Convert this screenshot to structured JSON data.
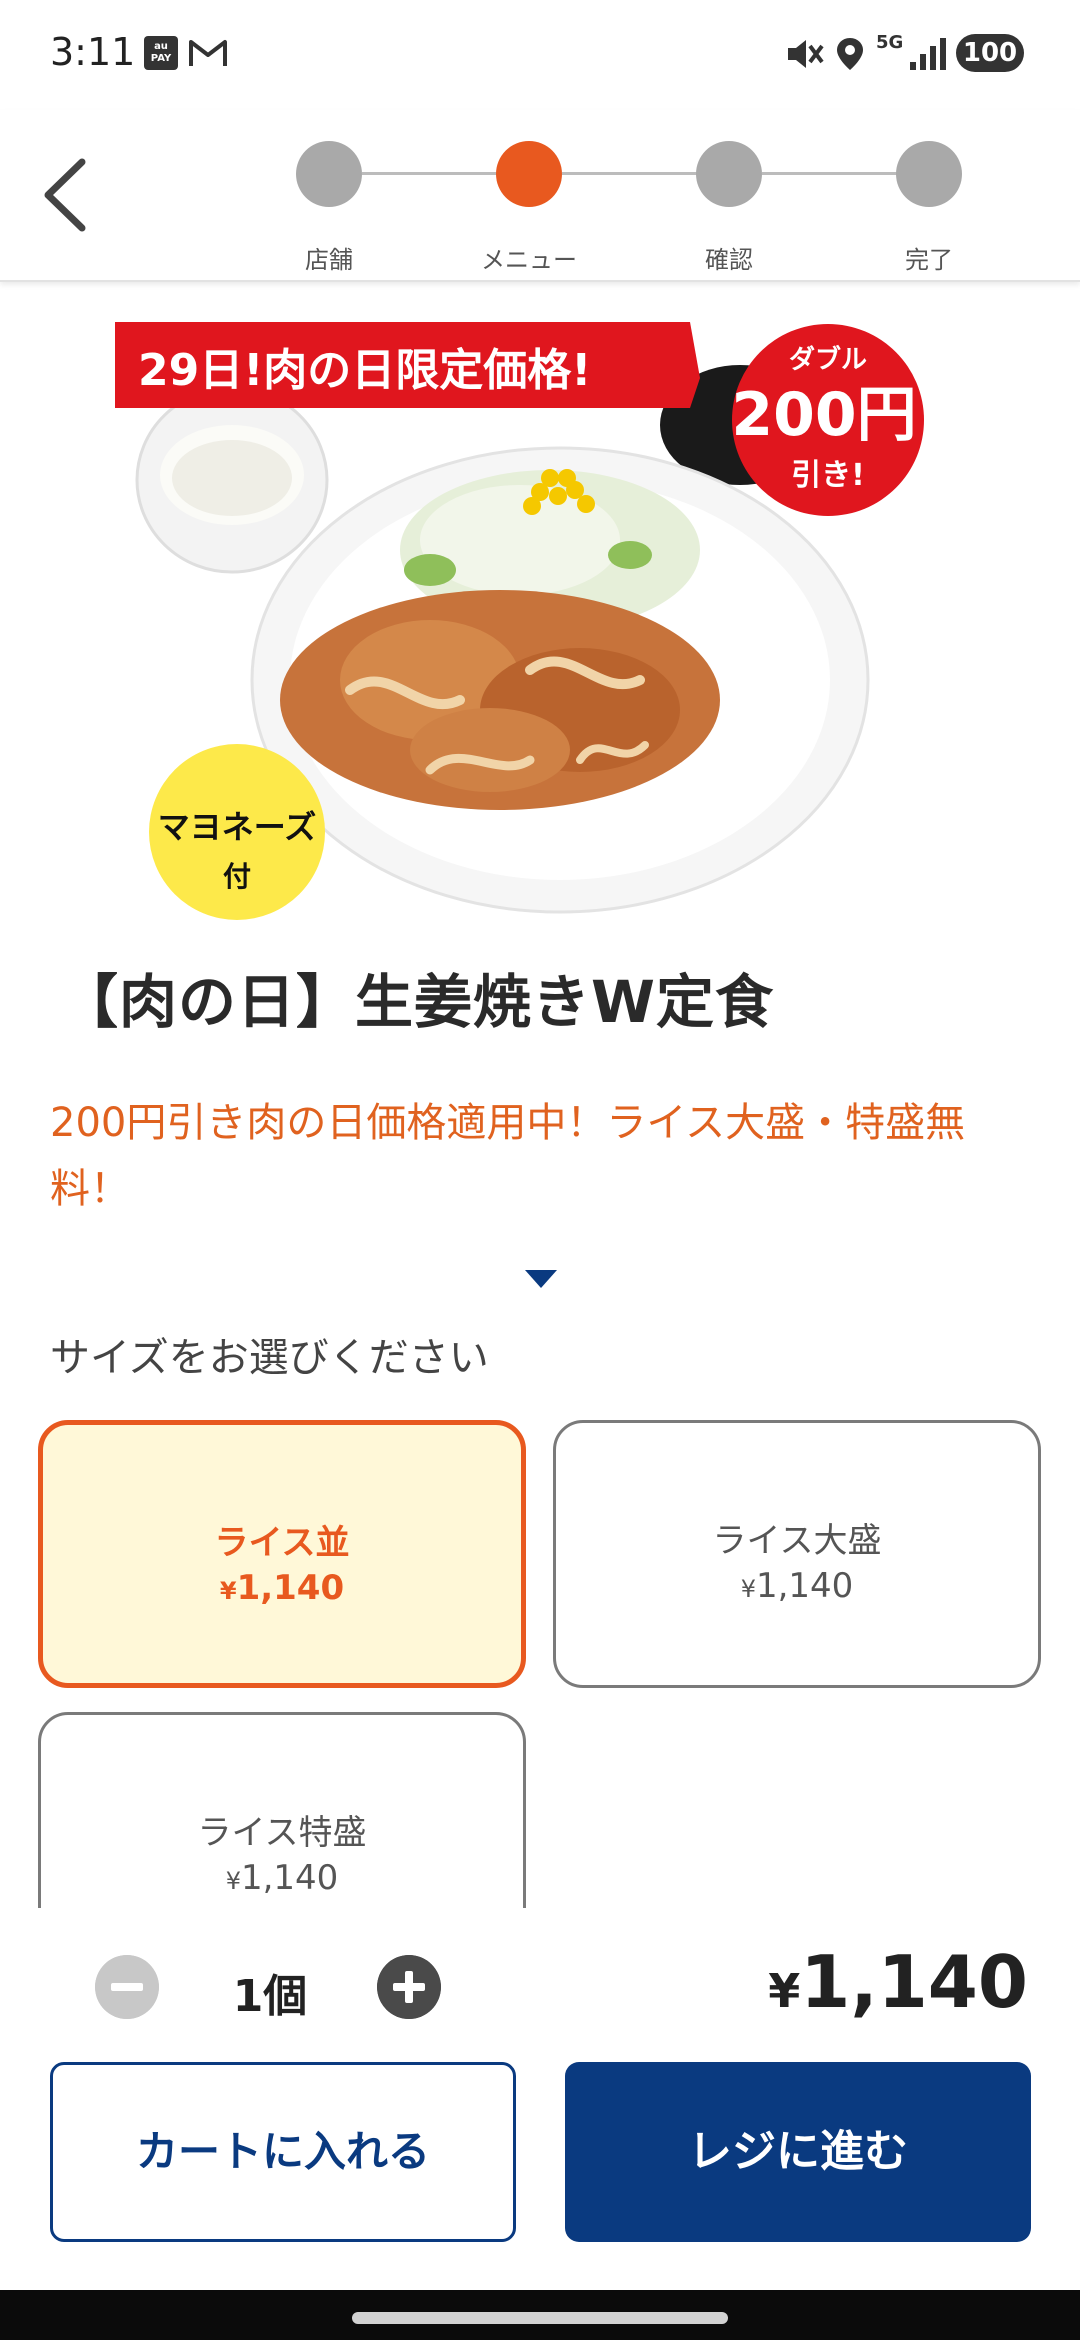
{
  "status_bar": {
    "time": "3:11",
    "pay_icon_label": "au PAY",
    "network": "5G",
    "battery": "100"
  },
  "header": {
    "steps": [
      {
        "label": "店舗",
        "active": false
      },
      {
        "label": "メニュー",
        "active": true
      },
      {
        "label": "確認",
        "active": false
      },
      {
        "label": "完了",
        "active": false
      }
    ]
  },
  "hero": {
    "banner_text": "29日!肉の日限定価格!",
    "discount_badge_top": "ダブル",
    "discount_badge_amount": "200円",
    "discount_badge_bottom": "引き!",
    "mayo_badge_line1": "マヨネーズ",
    "mayo_badge_line2": "付"
  },
  "product": {
    "title": "【肉の日】生姜焼きW定食",
    "promo": "200円引き肉の日価格適用中！ライス大盛・特盛無料！"
  },
  "size_section": {
    "prompt": "サイズをお選びください",
    "options": [
      {
        "name": "ライス並",
        "currency": "¥",
        "price": "1,140",
        "selected": true
      },
      {
        "name": "ライス大盛",
        "currency": "¥",
        "price": "1,140",
        "selected": false
      },
      {
        "name": "ライス特盛",
        "currency": "¥",
        "price": "1,140",
        "selected": false
      }
    ]
  },
  "order": {
    "quantity": "1個",
    "currency": "¥",
    "total": "1,140",
    "cart_label": "カートに入れる",
    "checkout_label": "レジに進む"
  },
  "colors": {
    "accent_orange": "#e8591f",
    "navy": "#0a3a80",
    "selected_bg": "#fff8d8",
    "banner_red": "#e0161e"
  }
}
